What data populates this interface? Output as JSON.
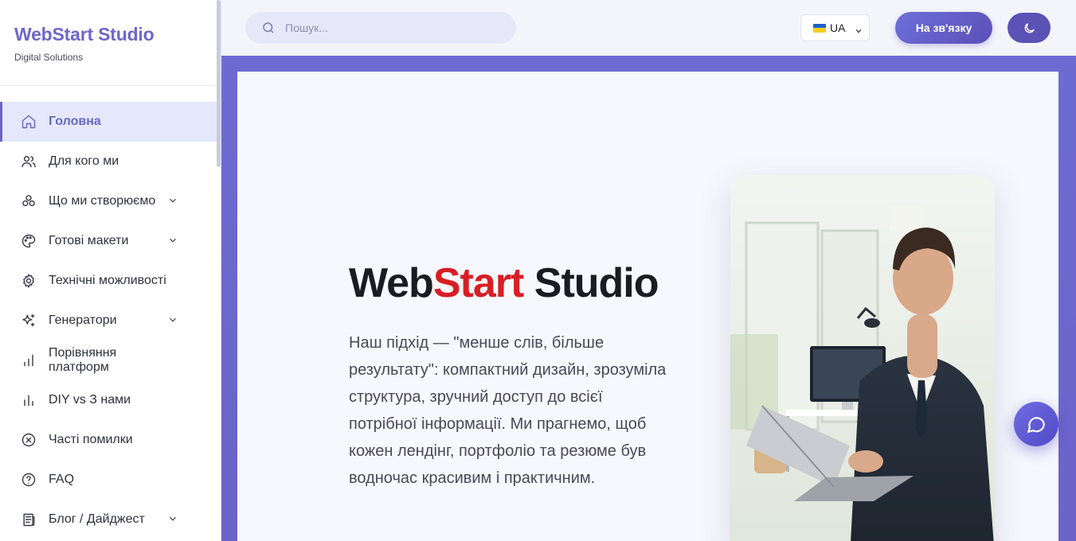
{
  "brand": {
    "title": "WebStart Studio",
    "subtitle": "Digital Solutions"
  },
  "sidebar": {
    "items": [
      {
        "label": "Головна",
        "icon": "home-icon",
        "active": true,
        "has_submenu": false
      },
      {
        "label": "Для кого ми",
        "icon": "users-icon",
        "active": false,
        "has_submenu": false
      },
      {
        "label": "Що ми створюємо",
        "icon": "shapes-icon",
        "active": false,
        "has_submenu": true
      },
      {
        "label": "Готові макети",
        "icon": "palette-icon",
        "active": false,
        "has_submenu": true
      },
      {
        "label": "Технічні можливості",
        "icon": "gear-icon",
        "active": false,
        "has_submenu": false
      },
      {
        "label": "Генератори",
        "icon": "sparkles-icon",
        "active": false,
        "has_submenu": true
      },
      {
        "label": "Порівняння платформ",
        "icon": "bar-chart-icon",
        "active": false,
        "has_submenu": false
      },
      {
        "label": "DIY vs З нами",
        "icon": "bar-chart-alt-icon",
        "active": false,
        "has_submenu": false
      },
      {
        "label": "Часті помилки",
        "icon": "x-circle-icon",
        "active": false,
        "has_submenu": false
      },
      {
        "label": "FAQ",
        "icon": "help-circle-icon",
        "active": false,
        "has_submenu": false
      },
      {
        "label": "Блог / Дайджест",
        "icon": "newspaper-icon",
        "active": false,
        "has_submenu": true
      }
    ]
  },
  "header": {
    "search_placeholder": "Пошук...",
    "language": "UA",
    "contact_label": "На зв'язку"
  },
  "hero": {
    "title_part1": "Web",
    "title_part2": "Start",
    "title_part3": " Studio",
    "text": "Наш підхід — \"менше слів, більше результату\": компактний дизайн, зрозуміла структура, зручний доступ до всієї потрібної інформації. Ми прагнемо, щоб кожен лендінг, портфоліо та резюме був водночас красивим і практичним."
  },
  "colors": {
    "accent": "#6a66c6",
    "brand_red": "#d81e24",
    "frame": "#6d6bd2"
  }
}
